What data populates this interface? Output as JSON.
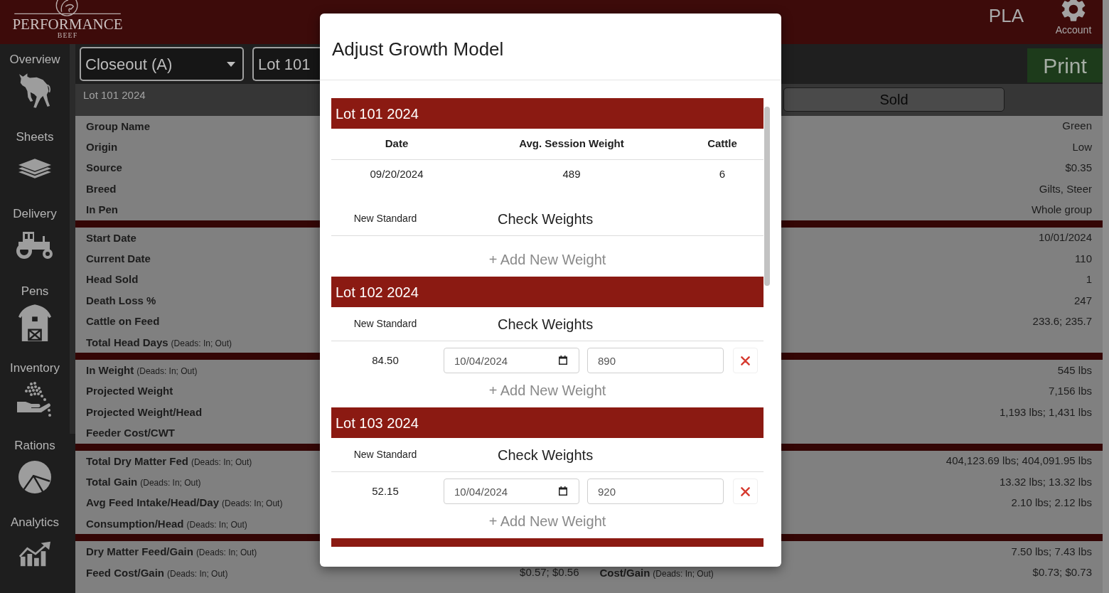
{
  "header": {
    "logo": {
      "name": "PERFORMANCE",
      "tagline": "BEEF"
    },
    "user": "PLA",
    "account": "Account"
  },
  "sidebar": {
    "items": [
      {
        "label": "Overview",
        "selected": false
      },
      {
        "label": "Sheets",
        "selected": false
      },
      {
        "label": "Delivery",
        "selected": false
      },
      {
        "label": "Pens",
        "selected": false
      },
      {
        "label": "Inventory",
        "selected": false
      },
      {
        "label": "Rations",
        "selected": false
      },
      {
        "label": "Analytics",
        "selected": false
      }
    ]
  },
  "toolbar": {
    "dropdowns": [
      {
        "value": "Closeout (A)"
      },
      {
        "value": "Lot 101"
      }
    ],
    "print": "Print"
  },
  "subbar": {
    "title": "Lot 101 2024",
    "status": "Sold"
  },
  "summary": {
    "sections": [
      {
        "rows": [
          {
            "label": "Group Name",
            "right_value": "Green"
          },
          {
            "label": "Origin",
            "right_value": "Low"
          },
          {
            "label": "Source",
            "right_value": "$0.35"
          },
          {
            "label": "Breed",
            "right_value": "Gilts, Steer"
          },
          {
            "label": "In Pen",
            "right_value": "Whole group"
          }
        ]
      },
      {
        "rows": [
          {
            "label": "Start Date",
            "right_value": "10/01/2024"
          },
          {
            "label": "Current Date",
            "right_value": "110"
          },
          {
            "label": "Head Sold",
            "right_value": "1"
          },
          {
            "label": "Death Loss %",
            "right_value": "247"
          },
          {
            "label": "Cattle on Feed",
            "right_value": "233.6; 235.7"
          },
          {
            "label": "Total Head Days",
            "note": "(Deads: In; Out)"
          }
        ]
      },
      {
        "rows": [
          {
            "label": "In Weight",
            "note": "(Deads: In; Out)",
            "right_value": "545 lbs"
          },
          {
            "label": "Projected Weight",
            "right_value": "7,156 lbs"
          },
          {
            "label": "Projected Weight/Head",
            "right_value": "1,193 lbs; 1,431 lbs"
          },
          {
            "label": "Feeder Cost/CWT"
          }
        ]
      },
      {
        "rows": [
          {
            "label": "Total Dry Matter Fed",
            "note": "(Deads: In; Out)",
            "right_value": "404,123.69 lbs; 404,091.95 lbs"
          },
          {
            "label": "Total Gain",
            "note": "(Deads: In; Out)",
            "right_value": "13.32 lbs; 13.32 lbs"
          },
          {
            "label": "Avg Feed Intake/Head/Day",
            "note": "(Deads: In; Out)",
            "right_value": "2.10 lbs; 2.12 lbs"
          },
          {
            "label": "Consumption/Head",
            "note": "(Deads: In; Out)"
          }
        ]
      },
      {
        "rows": [
          {
            "label": "Dry Matter Feed/Gain",
            "note": "(Deads: In; Out)",
            "right_value": "7.50 lbs; 7.43 lbs"
          },
          {
            "label": "Feed Cost/Gain",
            "note": "(Deads: In; Out)",
            "value": "$0.57; $0.56",
            "right_label": "Cost/Gain",
            "right_note": "(Deads: In; Out)",
            "right_value": "$0.73; $0.73"
          }
        ]
      }
    ]
  },
  "modal": {
    "title": "Adjust Growth Model",
    "lots": [
      {
        "title": "Lot 101 2024",
        "columns": [
          "Date",
          "Avg. Session Weight",
          "Cattle"
        ],
        "sessions": [
          [
            "09/20/2024",
            "489",
            "6"
          ]
        ],
        "standard_label": "New Standard",
        "check_label": "Check Weights",
        "add_label": "+ Add New Weight"
      },
      {
        "title": "Lot 102 2024",
        "standard_label": "New Standard",
        "check_label": "Check Weights",
        "weights": [
          {
            "standard": "84.50",
            "date": "10/04/2024",
            "weight": "890"
          }
        ],
        "add_label": "+ Add New Weight"
      },
      {
        "title": "Lot 103 2024",
        "standard_label": "New Standard",
        "check_label": "Check Weights",
        "weights": [
          {
            "standard": "52.15",
            "date": "10/04/2024",
            "weight": "920"
          }
        ],
        "add_label": "+ Add New Weight"
      }
    ],
    "more_below": true
  }
}
